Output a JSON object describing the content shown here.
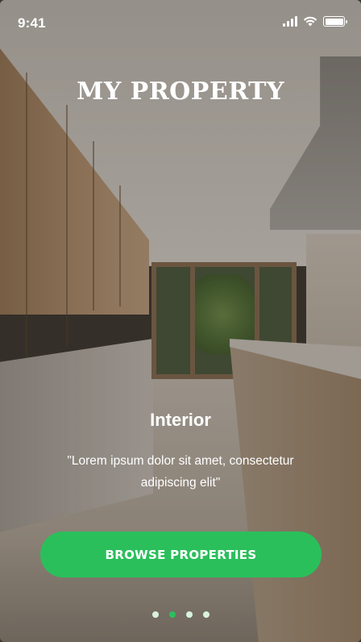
{
  "status_bar": {
    "time": "9:41",
    "icons": [
      "cellular-signal-icon",
      "wifi-icon",
      "battery-icon"
    ]
  },
  "app_title": "MY PROPERTY",
  "slide": {
    "title": "Interior",
    "description": "\"Lorem ipsum dolor sit amet, consectetur adipiscing elit\""
  },
  "cta": {
    "label": "BROWSE PROPERTIES"
  },
  "pager": {
    "count": 4,
    "active_index": 1
  },
  "colors": {
    "accent": "#2bbf5c",
    "text": "#ffffff"
  }
}
